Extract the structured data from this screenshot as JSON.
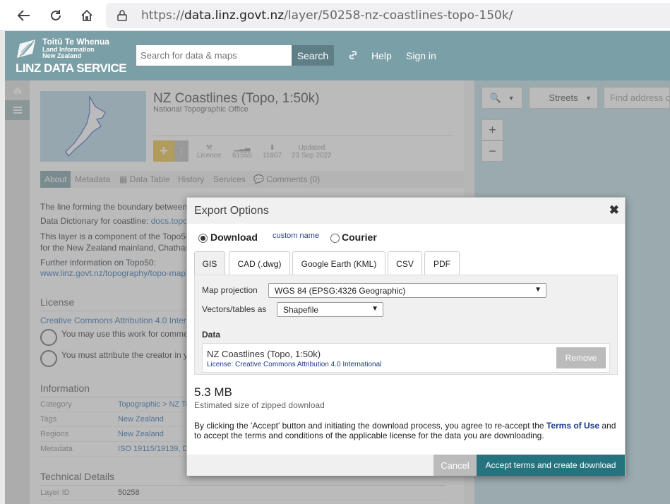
{
  "browser": {
    "url_prefix": "https://",
    "url_domain": "data.linz.govt.nz",
    "url_path": "/layer/50258-nz-coastlines-topo-150k/"
  },
  "header": {
    "logo_line1": "Toitū Te Whenua",
    "logo_line2": "Land Information",
    "logo_line3": "New Zealand",
    "logo_brand": "LINZ DATA SERVICE",
    "search_placeholder": "Search for data & maps",
    "search_button": "Search",
    "help": "Help",
    "signin": "Sign in"
  },
  "layer": {
    "title": "NZ Coastlines (Topo, 1:50k)",
    "publisher": "National Topographic Office",
    "licence_label": "Licence",
    "views": "61555",
    "downloads": "11807",
    "updated_label": "Updated",
    "updated_date": "23 Sep 2022"
  },
  "tabs": [
    "About",
    "Metadata",
    "Data Table",
    "History",
    "Services",
    "Comments (0)"
  ],
  "about": {
    "line1": "The line forming the boundary between",
    "dict_label": "Data Dictionary for coastline:",
    "dict_link": "docs.topo",
    "comp1": "This layer is a component of the Topo50",
    "comp2": "for the New Zealand mainland, Chathar",
    "further": "Further information on Topo50:",
    "further_link": "www.linz.govt.nz/topography/topo-map"
  },
  "license": {
    "heading": "License",
    "link": "Creative Commons Attribution 4.0 Inter",
    "may": "You may use this work for comme",
    "must": "You must attribute the creator in y"
  },
  "information": {
    "heading": "Information",
    "rows": [
      {
        "k": "Category",
        "v": "Topographic > NZ To"
      },
      {
        "k": "Tags",
        "v": "New Zealand"
      },
      {
        "k": "Regions",
        "v": "New Zealand"
      },
      {
        "k": "Metadata",
        "v": "ISO 19115/19139, D"
      }
    ]
  },
  "technical": {
    "heading": "Technical Details",
    "layer_id_label": "Layer ID",
    "layer_id": "50258"
  },
  "map": {
    "basemap": "Streets",
    "find_placeholder": "Find address or",
    "zoom_in": "+",
    "zoom_out": "−"
  },
  "modal": {
    "title": "Export Options",
    "close": "✖",
    "download": "Download",
    "custom_name": "custom name",
    "courier": "Courier",
    "format_tabs": [
      "GIS",
      "CAD (.dwg)",
      "Google Earth (KML)",
      "CSV",
      "PDF"
    ],
    "projection_label": "Map projection",
    "projection_value": "WGS 84 (EPSG:4326 Geographic)",
    "vectors_label": "Vectors/tables as",
    "vectors_value": "Shapefile",
    "data_label": "Data",
    "data_name": "NZ Coastlines (Topo, 1:50k)",
    "data_license": "License: Creative Commons Attribution 4.0 International",
    "remove": "Remove",
    "size": "5.3 MB",
    "size_sub": "Estimated size of zipped download",
    "terms_a": "By clicking the 'Accept' button and initiating the download process, you agree to re-accept the ",
    "terms_link": "Terms of Use",
    "terms_b": " and to accept the terms and conditions of the applicable license for the data you are downloading.",
    "cancel": "Cancel",
    "accept": "Accept terms and create download"
  },
  "colors": {
    "header_bg": "#7b9fa6",
    "accent_yellow": "#e8c040",
    "accept_btn": "#25737e"
  }
}
